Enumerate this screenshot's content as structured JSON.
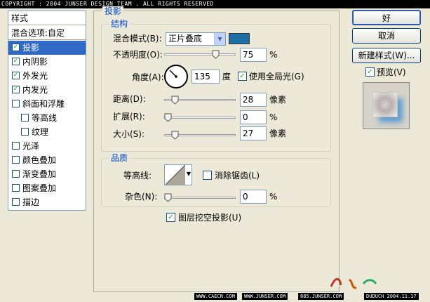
{
  "banner": "COPYRIGHT : 2004 JUNSER DESIGN TEAM . ALL RIGHTS RESERVED",
  "left_panel": {
    "header": "样式",
    "blend_options": "混合选项:自定",
    "items": [
      {
        "label": "投影",
        "checked": true,
        "selected": true,
        "indent": false
      },
      {
        "label": "内阴影",
        "checked": true,
        "selected": false,
        "indent": false
      },
      {
        "label": "外发光",
        "checked": true,
        "selected": false,
        "indent": false
      },
      {
        "label": "内发光",
        "checked": true,
        "selected": false,
        "indent": false
      },
      {
        "label": "斜面和浮雕",
        "checked": false,
        "selected": false,
        "indent": false
      },
      {
        "label": "等高线",
        "checked": false,
        "selected": false,
        "indent": true
      },
      {
        "label": "纹理",
        "checked": false,
        "selected": false,
        "indent": true
      },
      {
        "label": "光泽",
        "checked": false,
        "selected": false,
        "indent": false
      },
      {
        "label": "颜色叠加",
        "checked": false,
        "selected": false,
        "indent": false
      },
      {
        "label": "渐变叠加",
        "checked": false,
        "selected": false,
        "indent": false
      },
      {
        "label": "图案叠加",
        "checked": false,
        "selected": false,
        "indent": false
      },
      {
        "label": "描边",
        "checked": false,
        "selected": false,
        "indent": false
      }
    ]
  },
  "drop_shadow": {
    "title": "投影",
    "structure": {
      "title": "结构",
      "blend_mode_label": "混合模式(B):",
      "blend_mode_value": "正片叠底",
      "shadow_color": "#1e6fa8",
      "opacity_label": "不透明度(O):",
      "opacity_value": "75",
      "opacity_unit": "%",
      "opacity_fraction": 0.75,
      "angle_label": "角度(A):",
      "angle_value": "135",
      "angle_unit": "度",
      "global_light_label": "使用全局光(G)",
      "global_light_checked": true,
      "distance_label": "距离(D):",
      "distance_value": "28",
      "distance_unit": "像素",
      "distance_fraction": 0.11,
      "spread_label": "扩展(R):",
      "spread_value": "0",
      "spread_unit": "%",
      "spread_fraction": 0.0,
      "size_label": "大小(S):",
      "size_value": "27",
      "size_unit": "像素",
      "size_fraction": 0.11
    },
    "quality": {
      "title": "品质",
      "contour_label": "等高线:",
      "anti_alias_label": "消除锯齿(L)",
      "anti_alias_checked": false,
      "noise_label": "杂色(N):",
      "noise_value": "0",
      "noise_unit": "%",
      "noise_fraction": 0.0
    },
    "knockout_label": "图层挖空投影(U)",
    "knockout_checked": true
  },
  "buttons": {
    "ok": "好",
    "cancel": "取消",
    "new_style": "新建样式(W)..."
  },
  "preview": {
    "label": "预览(V)",
    "checked": true
  },
  "footer": {
    "site1": "WWW.CAECN.COM",
    "site2": "WWW.JUNSER.COM",
    "site3": "885.JUNSER.COM",
    "credit": "DUDUCH 2004.11.17"
  }
}
